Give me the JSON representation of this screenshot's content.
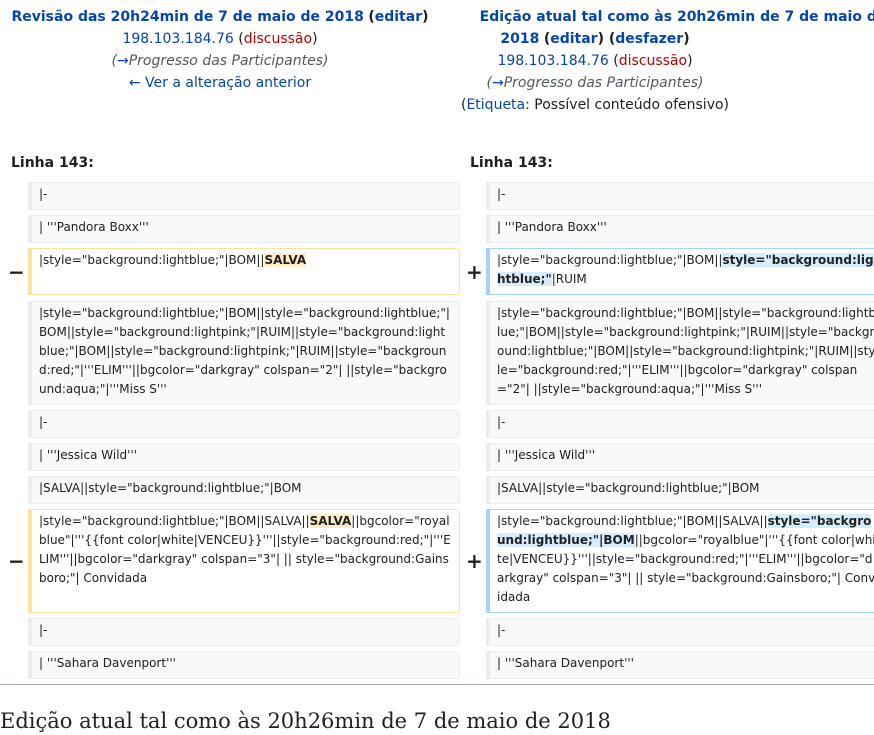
{
  "left_header": {
    "title": "Revisão das 20h24min de 7 de maio de 2018",
    "edit": "editar",
    "user": "198.103.184.76",
    "talk": "discussão",
    "comment_arrow": "→",
    "comment": "Progresso das Participantes",
    "prev": "← Ver a alteração anterior"
  },
  "right_header": {
    "title_line1": "Edição atual tal como às 20h26min de 7 de maio de",
    "title_line2": "2018",
    "edit": "editar",
    "undo": "desfazer",
    "user": "198.103.184.76",
    "talk": "discussão",
    "comment_arrow": "→",
    "comment": "Progresso das Participantes",
    "tag_label": "Etiqueta",
    "tag_value": ": Possível conteúdo ofensivo"
  },
  "line_label": "Linha 143:",
  "markers": {
    "minus": "−",
    "plus": "+"
  },
  "context": {
    "c1": "|-",
    "c2": "| '''Pandora Boxx'''",
    "c3": "|style=\"background:lightblue;\"|BOM||style=\"background:lightblue;\"|BOM||style=\"background:lightpink;\"|RUIM||style=\"background:lightblue;\"|BOM||style=\"background:lightpink;\"|RUIM||style=\"background:red;\"|'''ELIM'''||bgcolor=\"darkgray\" colspan=\"2\"| ||style=\"background:aqua;\"|'''Miss S'''",
    "c4": "|-",
    "c5": "| '''Jessica Wild'''",
    "c6": "|SALVA||style=\"background:lightblue;\"|BOM",
    "c7": "|-",
    "c8": "| '''Sahara Davenport'''"
  },
  "del1": {
    "pre": "|style=\"background:lightblue;\"|BOM||",
    "hl": "SALVA"
  },
  "add1": {
    "pre": "|style=\"background:lightblue;\"|BOM||",
    "hl": "style=\"background:lightblue;\"",
    "post": "|RUIM"
  },
  "del2": {
    "pre": "|style=\"background:lightblue;\"|BOM||SALVA||",
    "hl": "SALVA",
    "post": "||bgcolor=\"royalblue\"|'''{{font color|white|VENCEU}}'''||style=\"background:red;\"|'''ELIM'''||bgcolor=\"darkgray\" colspan=\"3\"| || style=\"background:Gainsboro;\"| Convidada"
  },
  "add2": {
    "pre": "|style=\"background:lightblue;\"|BOM||SALVA||",
    "hl": "style=\"background:lightblue;\"|BOM",
    "post": "||bgcolor=\"royalblue\"|'''{{font color|white|VENCEU}}'''||style=\"background:red;\"|'''ELIM'''||bgcolor=\"darkgray\" colspan=\"3\"| || style=\"background:Gainsboro;\"| Convidada"
  },
  "bottom_title": "Edição atual tal como às 20h26min de 7 de maio de 2018",
  "colors": {
    "link": "#0645ad",
    "talk": "#ba0000",
    "del_border": "#fde29b",
    "add_border": "#a3d3ff",
    "del_highlight": "#feeec8",
    "add_highlight": "#d8ecff"
  }
}
